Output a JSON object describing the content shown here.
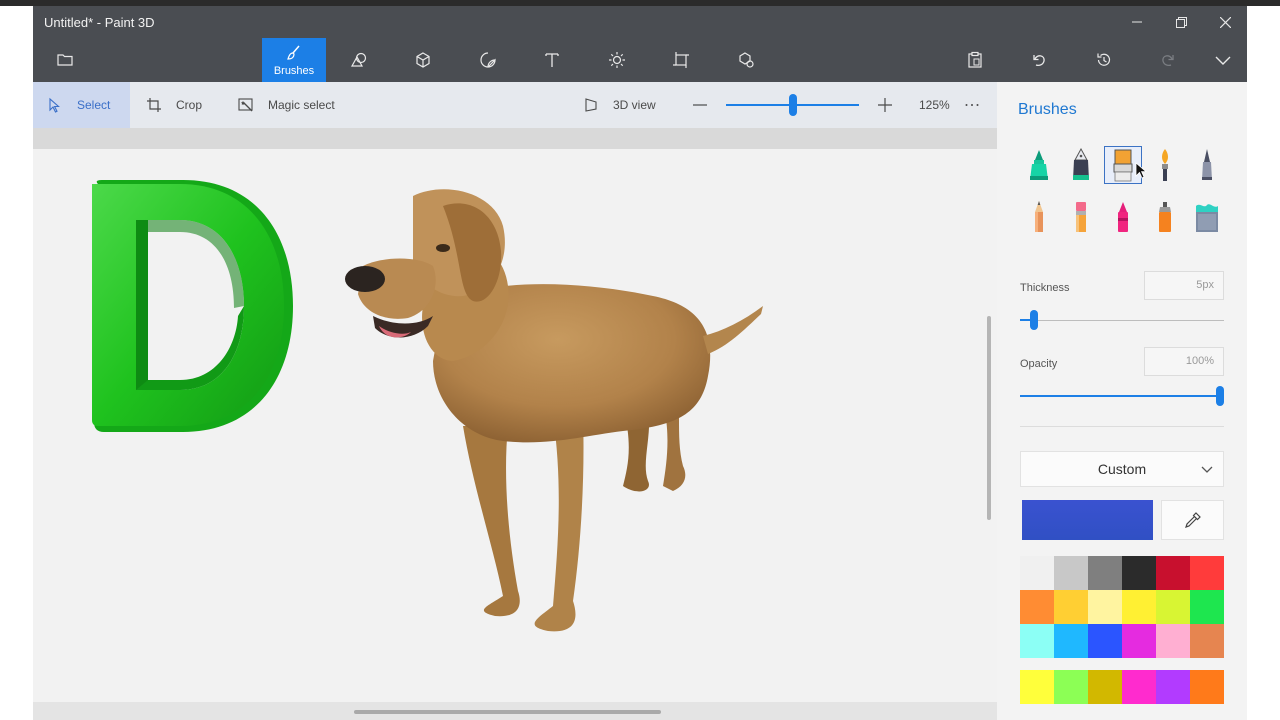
{
  "window": {
    "title": "Untitled* - Paint 3D"
  },
  "titlebar_icons": {
    "minimize": "minimize-icon",
    "maximize": "maximize-icon",
    "close": "close-icon"
  },
  "toolbar": {
    "active_tool_label": "Brushes",
    "tools": [
      "menu-folder-icon",
      "brushes-icon",
      "2d-shapes-icon",
      "3d-shapes-icon",
      "stickers-icon",
      "text-icon",
      "effects-icon",
      "canvas-icon",
      "3d-library-icon"
    ],
    "right_icons": [
      "paste-icon",
      "undo-icon",
      "history-icon",
      "redo-icon",
      "expand-icon"
    ]
  },
  "subbar": {
    "select_label": "Select",
    "crop_label": "Crop",
    "magic_select_label": "Magic select",
    "view3d_label": "3D view",
    "zoom_level": "125%",
    "zoom_fraction": 0.5
  },
  "panel": {
    "heading": "Brushes",
    "brushes": [
      "marker",
      "calligraphy-pen",
      "oil-brush",
      "watercolor",
      "pixel-pen",
      "pencil",
      "eraser",
      "crayon",
      "spray-can",
      "fill"
    ],
    "selected_brush": "oil-brush",
    "thickness_label": "Thickness",
    "thickness_value": "5px",
    "thickness_fraction": 0.05,
    "opacity_label": "Opacity",
    "opacity_value": "100%",
    "opacity_fraction": 1.0,
    "color_mode": "Custom",
    "current_color": "#3a52d0",
    "palette": [
      "#f0f0f0",
      "#c8c8c8",
      "#7f7f7f",
      "#2b2b2b",
      "#c8102e",
      "#ff3b3b",
      "#ff8c33",
      "#ffcf33",
      "#fff4a0",
      "#fff033",
      "#d8f533",
      "#1ee64f",
      "#8cfff5",
      "#1fb8ff",
      "#2b55ff",
      "#e52be0",
      "#ffafd2",
      "#e68550",
      "#ffff3b",
      "#8cff55",
      "#d2b800",
      "#ff2bce",
      "#b23bff",
      "#ff7a1a"
    ]
  }
}
